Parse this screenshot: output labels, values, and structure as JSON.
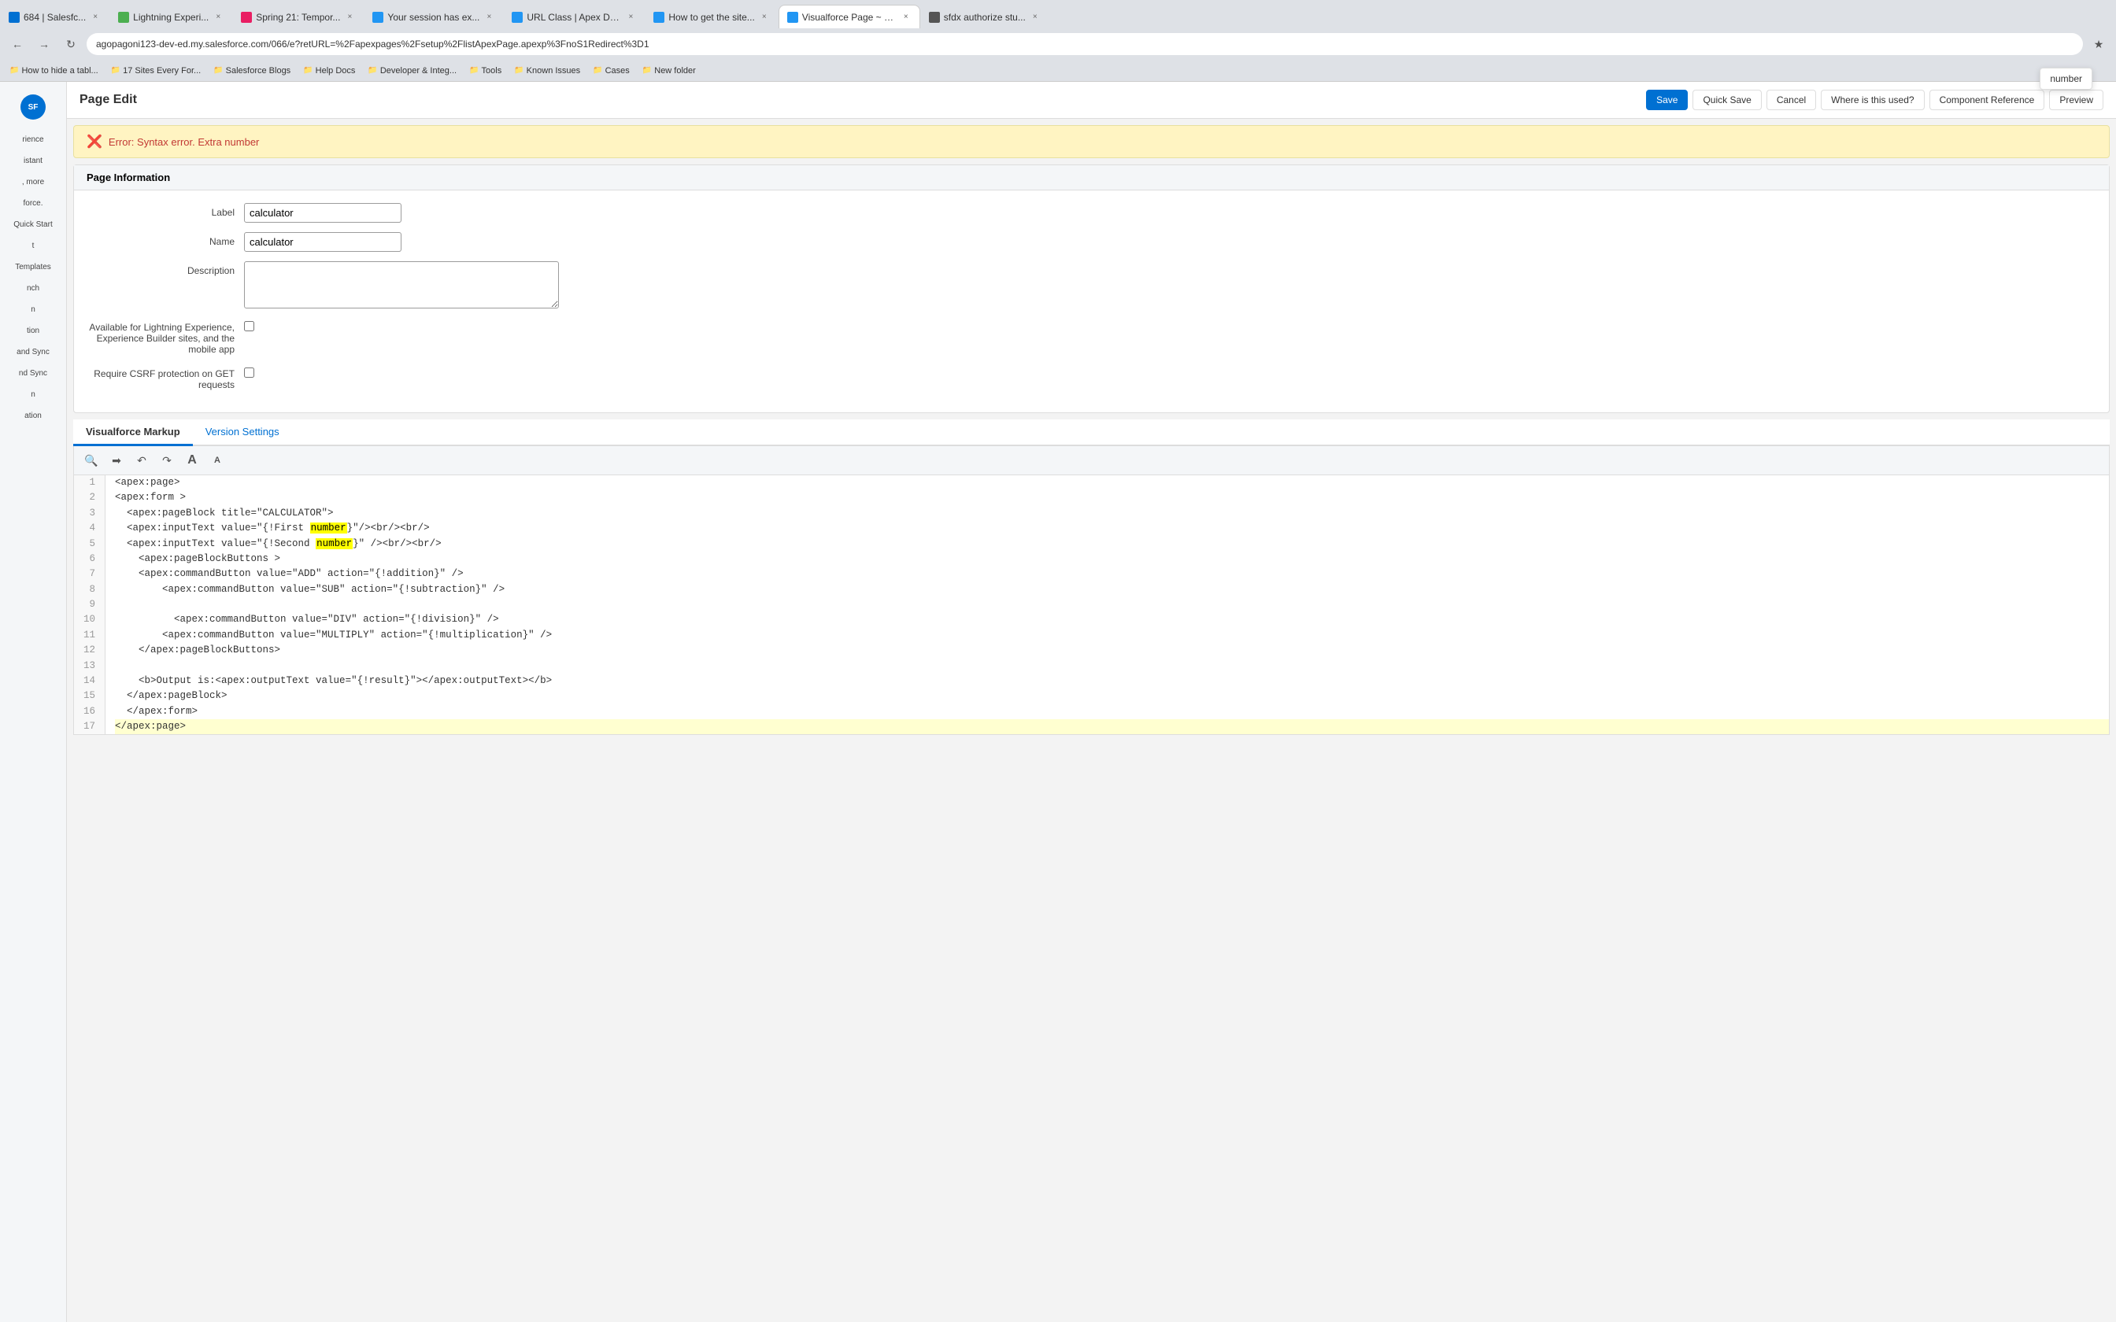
{
  "browser": {
    "tabs": [
      {
        "id": "tab1",
        "label": "684 | Salesfc...",
        "favicon_color": "#0070d2",
        "active": false
      },
      {
        "id": "tab2",
        "label": "Lightning Experi...",
        "favicon_color": "#4caf50",
        "active": false
      },
      {
        "id": "tab3",
        "label": "Spring 21: Tempor...",
        "favicon_color": "#e91e63",
        "active": false
      },
      {
        "id": "tab4",
        "label": "Your session has ex...",
        "favicon_color": "#2196f3",
        "active": false
      },
      {
        "id": "tab5",
        "label": "URL Class | Apex De...",
        "favicon_color": "#2196f3",
        "active": false
      },
      {
        "id": "tab6",
        "label": "How to get the site...",
        "favicon_color": "#2196f3",
        "active": false
      },
      {
        "id": "tab7",
        "label": "Visualforce Page ~ S...",
        "favicon_color": "#2196f3",
        "active": true
      },
      {
        "id": "tab8",
        "label": "sfdx authorize stu...",
        "favicon_color": "#555",
        "active": false
      }
    ],
    "address": "agopagoni123-dev-ed.my.salesforce.com/066/e?retURL=%2Fapexpages%2Fsetup%2FlistApexPage.apexp%3FnoS1Redirect%3D1",
    "bookmarks": [
      {
        "label": "How to hide a tabl..."
      },
      {
        "label": "17 Sites Every For..."
      },
      {
        "label": "Salesforce Blogs"
      },
      {
        "label": "Help Docs"
      },
      {
        "label": "Developer & Integ..."
      },
      {
        "label": "Tools"
      },
      {
        "label": "Known Issues"
      },
      {
        "label": "Cases"
      },
      {
        "label": "New folder"
      }
    ]
  },
  "tooltip": {
    "text": "number",
    "position_label": "top-right"
  },
  "page": {
    "title": "Page Edit",
    "buttons": {
      "save": "Save",
      "quick_save": "Quick Save",
      "cancel": "Cancel",
      "where_used": "Where is this used?",
      "component_ref": "Component Reference",
      "preview": "Preview"
    }
  },
  "error": {
    "message": "Error: Syntax error. Extra number"
  },
  "page_info": {
    "section_title": "Page Information",
    "label_field": "Label",
    "name_field": "Name",
    "desc_field": "Description",
    "lightning_field": "Available for Lightning Experience, Experience Builder sites, and the mobile app",
    "csrf_field": "Require CSRF protection on GET requests",
    "label_value": "calculator",
    "name_value": "calculator",
    "desc_value": "",
    "lightning_checked": false,
    "csrf_checked": false
  },
  "tabs": [
    {
      "id": "vf-markup",
      "label": "Visualforce Markup",
      "active": true
    },
    {
      "id": "version-settings",
      "label": "Version Settings",
      "active": false
    }
  ],
  "editor": {
    "toolbar": {
      "search": "🔍",
      "forward": "→",
      "undo": "↩",
      "redo": "↪",
      "font_large": "A",
      "font_small": "A"
    },
    "lines": [
      {
        "num": 1,
        "code": "<apex:page>",
        "highlight": false
      },
      {
        "num": 2,
        "code": "<apex:form >",
        "highlight": false
      },
      {
        "num": 3,
        "code": "  <apex:pageBlock title=\"CALCULATOR\">",
        "highlight": false
      },
      {
        "num": 4,
        "code": "  <apex:inputText value=\"{!First number}\"/><br/><br/>",
        "highlight": false
      },
      {
        "num": 5,
        "code": "  <apex:inputText value=\"{!Second number}\" /><br/><br/>",
        "highlight": false
      },
      {
        "num": 6,
        "code": "    <apex:pageBlockButtons >",
        "highlight": false
      },
      {
        "num": 7,
        "code": "    <apex:commandButton value=\"ADD\" action=\"{!addition}\" />",
        "highlight": false
      },
      {
        "num": 8,
        "code": "        <apex:commandButton value=\"SUB\" action=\"{!subtraction}\" />",
        "highlight": false
      },
      {
        "num": 9,
        "code": "",
        "highlight": false
      },
      {
        "num": 10,
        "code": "          <apex:commandButton value=\"DIV\" action=\"{!division}\" />",
        "highlight": false
      },
      {
        "num": 11,
        "code": "        <apex:commandButton value=\"MULTIPLY\" action=\"{!multiplication}\" />",
        "highlight": false
      },
      {
        "num": 12,
        "code": "    </apex:pageBlockButtons>",
        "highlight": false
      },
      {
        "num": 13,
        "code": "",
        "highlight": false
      },
      {
        "num": 14,
        "code": "    <b>Output is:<apex:outputText value=\"{!result}\"></apex:outputText></b>",
        "highlight": false
      },
      {
        "num": 15,
        "code": "  </apex:pageBlock>",
        "highlight": false
      },
      {
        "num": 16,
        "code": "  </apex:form>",
        "highlight": false
      },
      {
        "num": 17,
        "code": "</apex:page>",
        "highlight": true
      }
    ]
  },
  "sidebar": {
    "items": [
      {
        "label": "rience",
        "id": "experience"
      },
      {
        "label": "istant",
        "id": "assistant"
      },
      {
        "label": ", more",
        "id": "more"
      },
      {
        "label": "force.",
        "id": "salesforce"
      },
      {
        "label": "Quick Start",
        "id": "quick-start"
      },
      {
        "label": "t",
        "id": "item-t"
      },
      {
        "label": "Templates",
        "id": "templates"
      },
      {
        "label": "nch",
        "id": "nch"
      },
      {
        "label": "n",
        "id": "n"
      },
      {
        "label": "tion",
        "id": "tion"
      },
      {
        "label": "and Sync",
        "id": "and-sync"
      },
      {
        "label": "nd Sync",
        "id": "nd-sync"
      },
      {
        "label": "n",
        "id": "n2"
      },
      {
        "label": "ation",
        "id": "ation"
      }
    ]
  }
}
